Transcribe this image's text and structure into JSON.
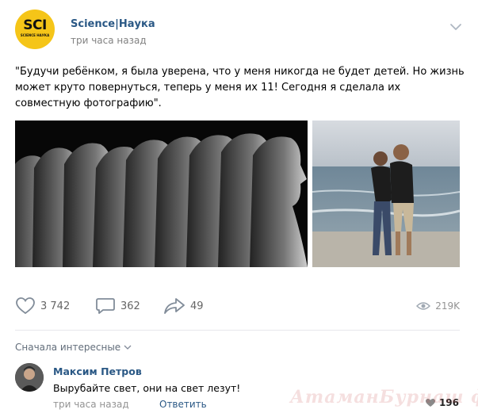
{
  "post": {
    "author": "Science|Наука",
    "time": "три часа назад",
    "avatar_text": "SCI",
    "avatar_subtext": "SCIENCE НАУКА",
    "text": "\"Будучи ребёнком, я была уверена, что у меня никогда не будет детей. Но жизнь может круто повернуться, теперь у меня их 11! Сегодня я сделала их совместную фотографию\".",
    "likes": "3 742",
    "comments": "362",
    "shares": "49",
    "views": "219K"
  },
  "comments_section": {
    "sort_label": "Сначала интересные",
    "items": [
      {
        "author": "Максим Петров",
        "text": "Вырубайте свет, они на свет лезут!",
        "time": "три часа назад",
        "reply_label": "Ответить",
        "likes": "196"
      }
    ]
  },
  "watermark": "АтаманБурнаш фот.RU",
  "colors": {
    "link": "#2a5885",
    "muted": "#828282",
    "avatar_bg": "#f5c518"
  }
}
